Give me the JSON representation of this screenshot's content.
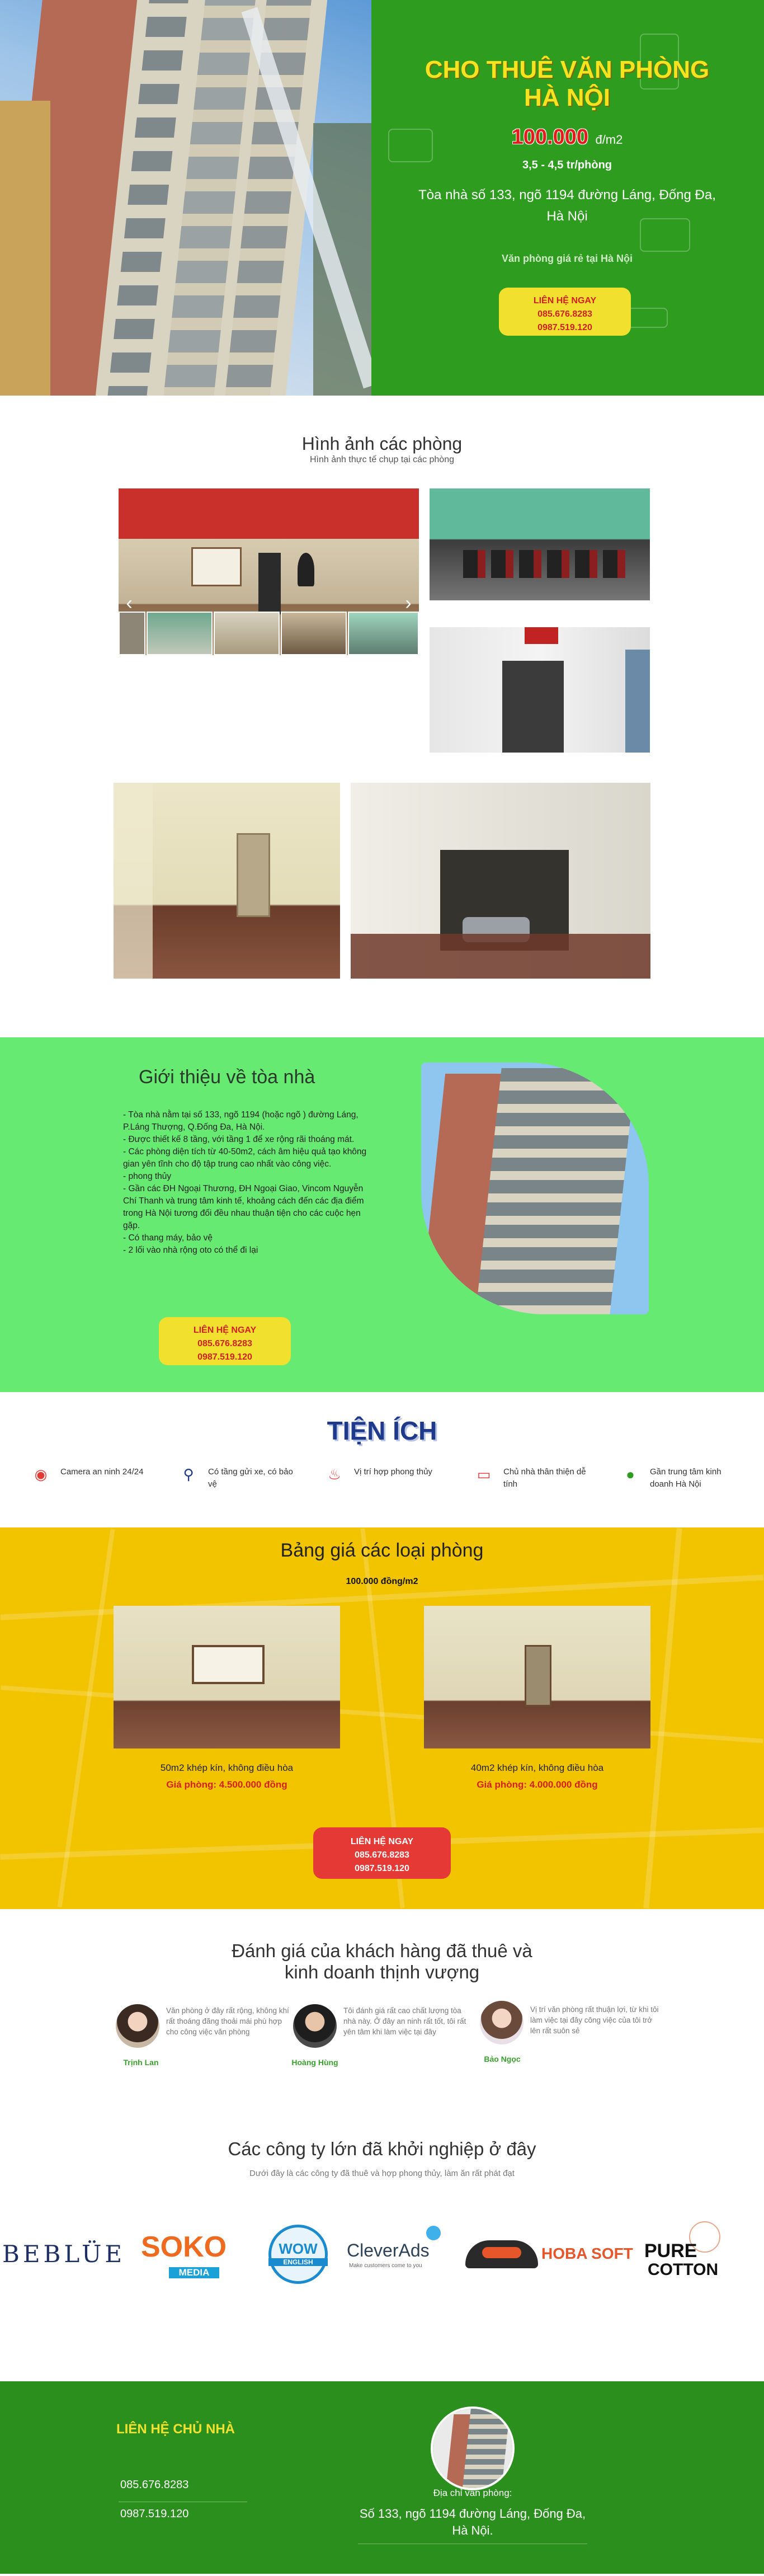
{
  "hero": {
    "title": "CHO THUÊ VĂN PHÒNG HÀ NỘI",
    "price_value": "100.000",
    "price_unit": "đ/m2",
    "price_range": "3,5 - 4,5 tr/phòng",
    "address": "Tòa nhà số 133, ngõ 1194 đường Láng, Đống Đa, Hà Nội",
    "tagline": "Văn phòng giá rẻ tại Hà Nội",
    "cta": {
      "label": "LIÊN HỆ NGAY",
      "phone1": "085.676.8283",
      "phone2": "0987.519.120"
    }
  },
  "gallery": {
    "title": "Hình ảnh các phòng",
    "subtitle": "Hình ảnh thực tế chụp tại các phòng"
  },
  "intro": {
    "title": "Giới thiệu về tòa nhà",
    "items": [
      "- Tòa nhà nằm tại số 133, ngõ 1194 (hoặc ngõ ) đường Láng, P.Láng Thượng, Q.Đống Đa, Hà Nội.",
      "- Được thiết kế 8 tầng, với tầng 1 để xe rộng rãi thoáng mát.",
      "- Các phòng diện tích từ 40-50m2, cách âm hiệu quả tạo không gian yên tĩnh cho độ tập trung cao nhất vào công việc.",
      "- phong thủy",
      "- Gần các ĐH Ngoại Thương, ĐH Ngoại Giao, Vincom Nguyễn Chí Thanh và trung tâm kinh tế, khoảng cách đến các địa điểm trong Hà Nội tương đối đều nhau thuận tiện cho các cuộc hẹn gặp.",
      "- Có thang máy, bảo vệ",
      "- 2 lối vào nhà rộng oto có thể đi lại"
    ],
    "cta": {
      "label": "LIÊN HỆ NGAY",
      "phone1": "085.676.8283",
      "phone2": "0987.519.120"
    }
  },
  "amenities": {
    "title": "TIỆN ÍCH",
    "items": [
      {
        "icon": "camera-icon",
        "label": "Camera an ninh 24/24"
      },
      {
        "icon": "bike-icon",
        "label": "Có tầng gửi xe, có bảo vệ"
      },
      {
        "icon": "feng-shui-icon",
        "label": "Vị trí hợp phong thủy"
      },
      {
        "icon": "monitor-icon",
        "label": "Chủ nhà thân thiện dễ tính"
      },
      {
        "icon": "location-icon",
        "label": "Gần trung tâm kinh doanh Hà Nội"
      }
    ]
  },
  "prices": {
    "title": "Bảng giá các loại phòng",
    "subtitle": "100.000 đồng/m2",
    "cards": [
      {
        "caption": "50m2 khép kín, không điều hòa",
        "price": "Giá phòng: 4.500.000 đồng"
      },
      {
        "caption": "40m2 khép kín, không điều hòa",
        "price": "Giá phòng: 4.000.000 đồng"
      }
    ],
    "cta": {
      "label": "LIÊN HỆ NGAY",
      "phone1": "085.676.8283",
      "phone2": "0987.519.120"
    }
  },
  "reviews": {
    "title": "Đánh giá của khách hàng đã thuê và kinh doanh thịnh vượng",
    "items": [
      {
        "name": "Trịnh Lan",
        "text": "Văn phòng ở đây rất rộng, không khí rất thoáng đãng thoải mái phù hợp cho công việc văn phòng"
      },
      {
        "name": "Hoàng Hùng",
        "text": "Tôi đánh giá rất cao chất lượng tòa nhà này. Ở đây an ninh rất tốt, tôi rất yên tâm khi làm việc tại đây"
      },
      {
        "name": "Bảo Ngọc",
        "text": "Vị trí văn phòng rất thuận lợi, từ khi tôi làm việc tại đây công việc của tôi trở lên rất suôn sẻ"
      }
    ]
  },
  "partners": {
    "title": "Các công ty lớn đã khởi nghiệp ở đây",
    "subtitle": "Dưới đây là các công ty đã thuê và hợp phong thủy, làm ăn rất phát đạt",
    "logos": [
      {
        "name": "BEBLÜE"
      },
      {
        "name": "SOKO",
        "sub": "MEDIA"
      },
      {
        "name": "WOW",
        "sub": "ENGLISH"
      },
      {
        "name": "CleverAds",
        "sub": "Make customers come to you"
      },
      {
        "name": "HOBA SOFT"
      },
      {
        "name": "PURE",
        "sub": "COTTON"
      }
    ]
  },
  "footer": {
    "title": "LIÊN HỆ CHỦ NHÀ",
    "phone1": "085.676.8283",
    "phone2": "0987.519.120",
    "address_label": "Địa chỉ văn phòng:",
    "address": "Số 133, ngõ 1194 đường Láng, Đống Đa, Hà Nội."
  },
  "colors": {
    "green": "#2e9d1f",
    "light_green": "#66ea72",
    "yellow": "#f2c400",
    "red": "#e53935",
    "navy": "#1f3a8a"
  }
}
